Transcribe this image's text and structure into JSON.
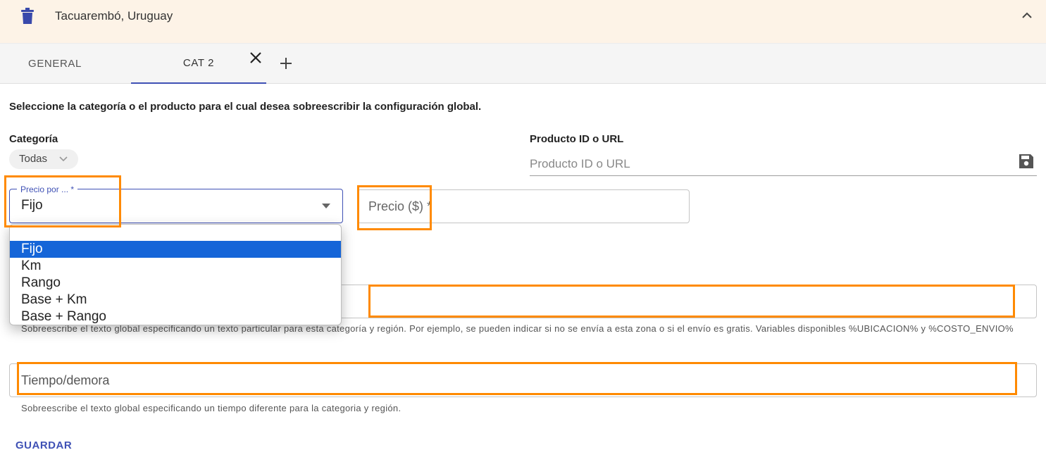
{
  "header": {
    "region_title": "Tacuarembó, Uruguay",
    "trash_icon": "trash-icon",
    "collapse_icon": "chevron-up-icon"
  },
  "tabs": [
    {
      "label": "GENERAL",
      "active": false
    },
    {
      "label": "CAT 2",
      "active": true
    }
  ],
  "tab_actions": {
    "close_icon": "close-icon",
    "add_icon": "plus-icon"
  },
  "form": {
    "instructions": "Seleccione la categoría o el producto para el cual desea sobreescribir la configuración global.",
    "category": {
      "label": "Categoría",
      "value": "Todas"
    },
    "product": {
      "label": "Producto ID o URL",
      "placeholder": "Producto ID o URL",
      "save_icon": "floppy-disk-icon"
    },
    "price_per": {
      "label": "Precio por ... *",
      "value": "Fijo",
      "options": [
        "Fijo",
        "Km",
        "Rango",
        "Base + Km",
        "Base + Rango"
      ],
      "selected_index": 0
    },
    "price": {
      "placeholder": "Precio ($) *"
    },
    "text_override": {
      "value": "",
      "helper": "Sobreescribe el texto global especificando un texto particular para esta categoría y región. Por ejemplo, se pueden indicar si no se envía a esta zona o si el envío es gratis. Variables disponibles %UBICACION% y %COSTO_ENVIO%"
    },
    "time": {
      "placeholder": "Tiempo/demora",
      "helper": "Sobreescribe el texto global especificando un tiempo diferente para la categoria y región."
    },
    "save_label": "GUARDAR"
  },
  "colors": {
    "accent": "#3f51b5",
    "header_bg": "#fdf3e7",
    "highlight": "#ff8a00",
    "option_selected": "#1565d8"
  }
}
